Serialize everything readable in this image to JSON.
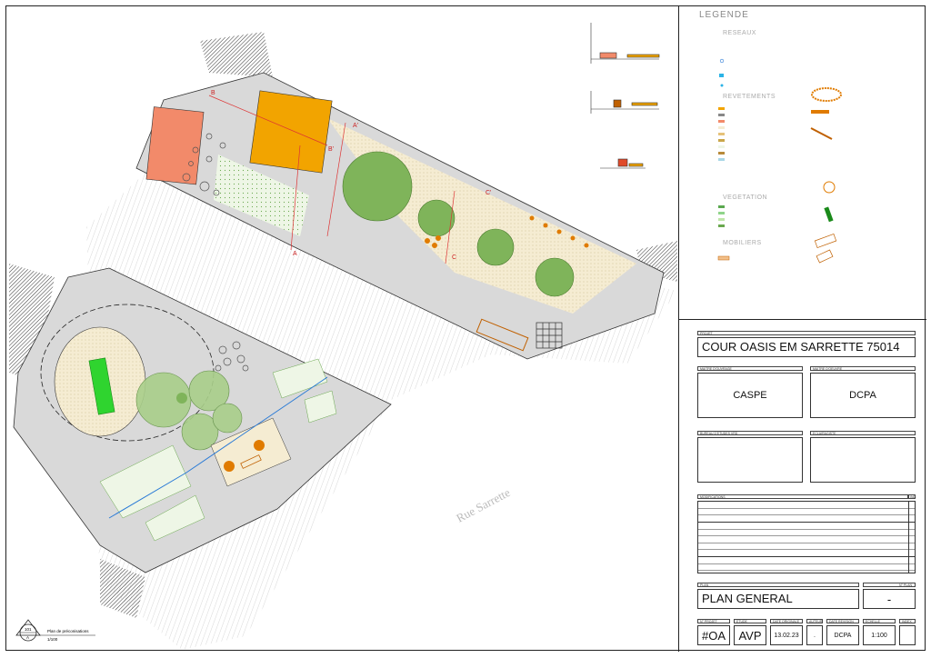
{
  "plan": {
    "street_name": "Rue Sarrette",
    "section_marks": [
      "B",
      "B'",
      "A",
      "A'",
      "C",
      "C'"
    ],
    "view": {
      "number": "101",
      "letter": "A",
      "label": "Plan de préconisations",
      "scale": "1/100"
    }
  },
  "legend": {
    "title": "LEGENDE",
    "sections": {
      "networks": "RESEAUX",
      "coverings": "REVETEMENTS",
      "vegetation": "VEGETATION",
      "furniture": "MOBILIERS"
    }
  },
  "cartouche": {
    "project_label": "PROJET",
    "project": "COUR OASIS EM SARRETTE 75014",
    "owner_label": "MAITRE D'OUVRAGE",
    "owner": "CASPE",
    "manager_label": "MAITRE D'OEUVRE",
    "manager": "DCPA",
    "bet_label": "BUREAU D'ETUDES VRD",
    "landscape_label": "ECLAIRAGISTE",
    "modifications_label": "MODIFICATIONS",
    "ind_label": "IND.",
    "plan_label": "PLAN",
    "plan_num_label": "N° PLAN",
    "plan_title": "PLAN GENERAL",
    "plan_number": "-",
    "fields": {
      "project_no_label": "N° PROJET",
      "project_no": "#OA",
      "phase_label": "ETUDE",
      "phase": "AVP",
      "date_label": "DATE ORIGINALE",
      "date": "13.02.23",
      "author_label": "AUTEUR",
      "author": ".",
      "rev_label": "DATE REVISION",
      "rev": "DCPA",
      "scale_label": "ECHELLE",
      "scale": "1:100",
      "index_label": "INDEX",
      "index": ""
    }
  },
  "colors": {
    "orange": "#f2a400",
    "salmon": "#f28a6a",
    "green": "#2fd42f",
    "tree": "#7fb45a",
    "pavement": "#d9d9d9"
  }
}
